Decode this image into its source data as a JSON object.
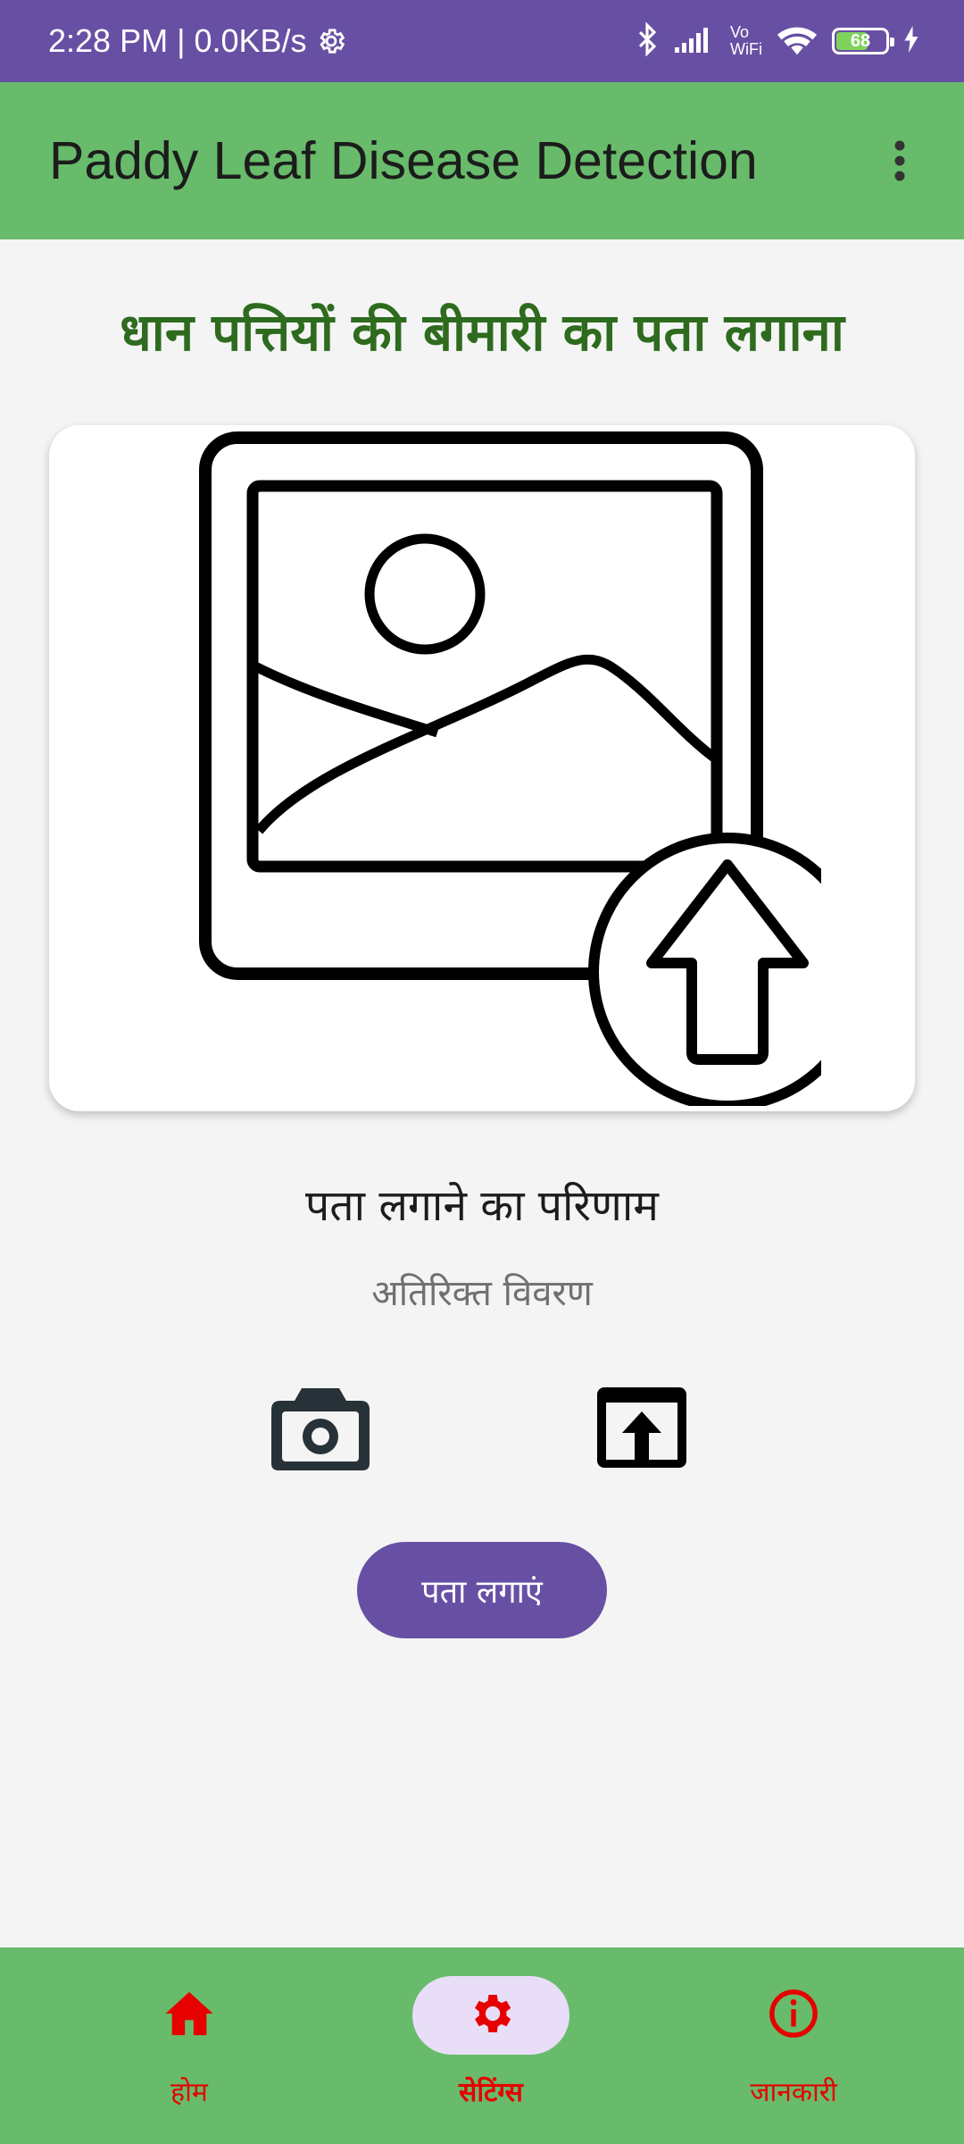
{
  "status_bar": {
    "time": "2:28 PM",
    "network_speed": "0.0KB/s",
    "volte_top": "Vo",
    "volte_bottom": "WiFi",
    "battery_level": "68",
    "battery_fraction": 0.68,
    "icons": [
      "settings-gear-icon",
      "bluetooth-icon",
      "signal-icon",
      "vowifi-icon",
      "wifi-icon",
      "battery-icon",
      "charging-bolt-icon"
    ]
  },
  "app_bar": {
    "title": "Paddy Leaf Disease Detection",
    "overflow_icon": "more-vert-icon"
  },
  "main": {
    "headline": "धान पत्तियों की बीमारी का पता लगाना",
    "image_placeholder_icon": "image-upload-icon",
    "result_title": "पता लगाने का परिणाम",
    "result_details": "अतिरिक्त विवरण",
    "camera_icon": "camera-icon",
    "gallery_icon": "open-upload-icon",
    "detect_button": "पता लगाएं"
  },
  "bottom_nav": {
    "items": [
      {
        "label": "होम",
        "icon": "home-icon",
        "active": false
      },
      {
        "label": "सेटिंग्स",
        "icon": "settings-icon",
        "active": true
      },
      {
        "label": "जानकारी",
        "icon": "info-icon",
        "active": false
      }
    ]
  },
  "colors": {
    "status_bar": "#6750a4",
    "app_bar": "#68bb6a",
    "headline": "#2e6b1e",
    "detect_button": "#6750a4",
    "nav_label": "#e60000",
    "nav_active_pill": "#e8def8"
  }
}
